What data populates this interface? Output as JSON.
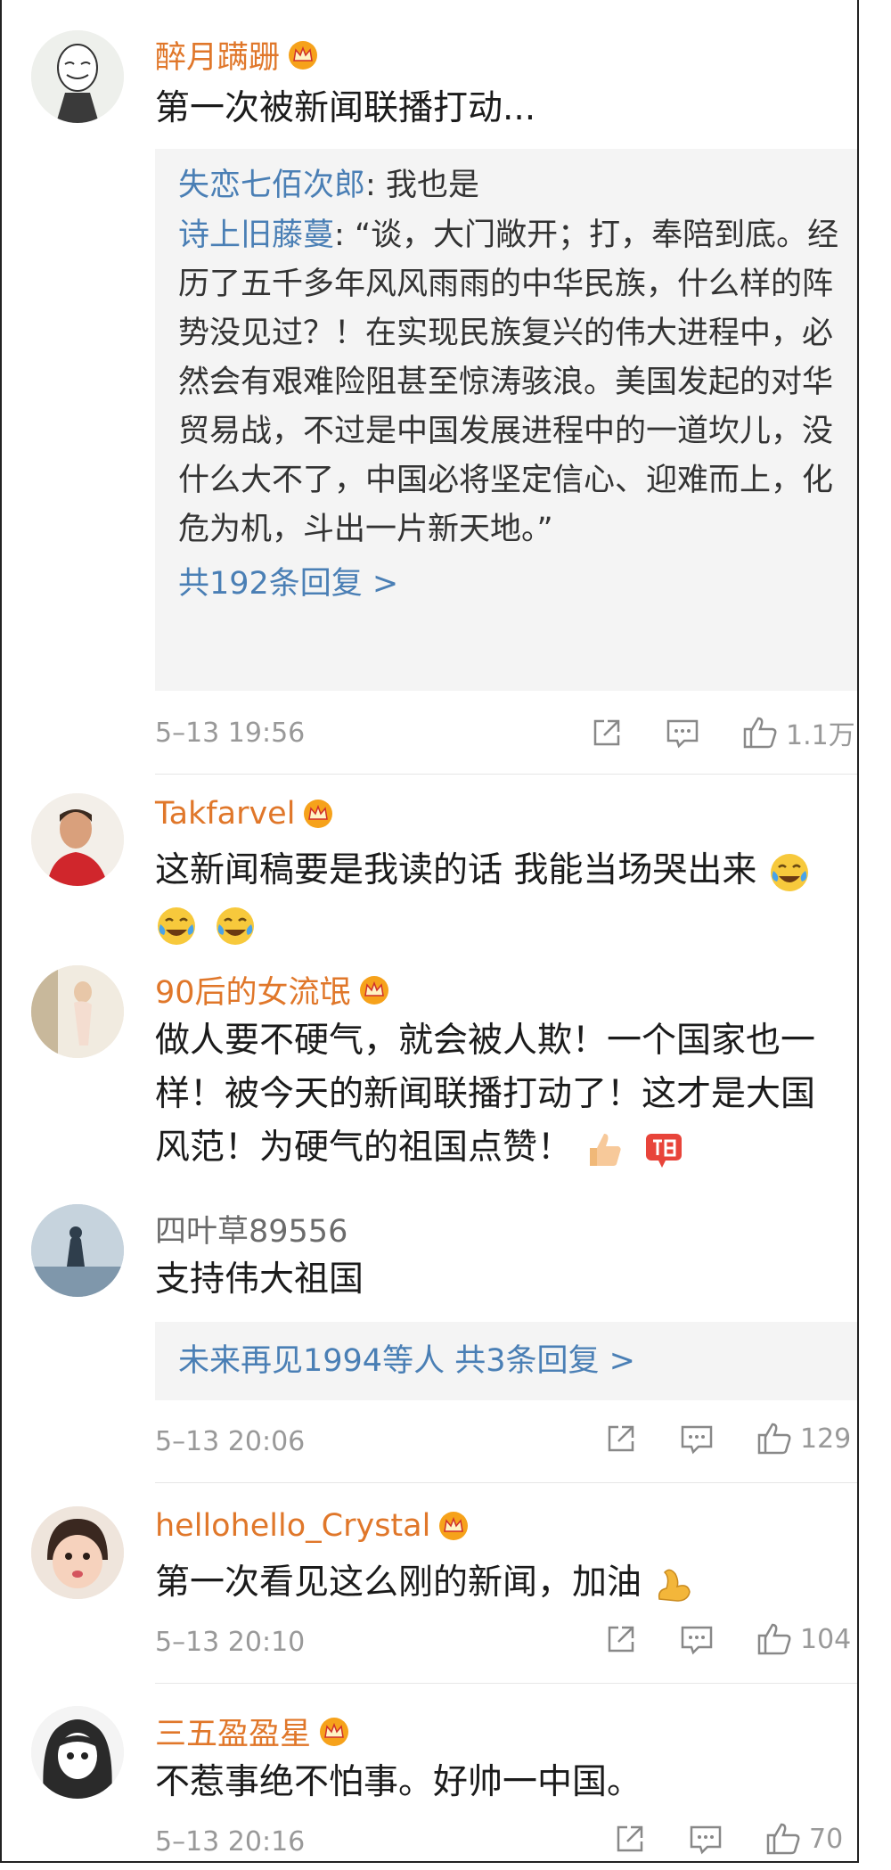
{
  "comments": [
    {
      "name": "醉月蹒跚",
      "text": "第一次被新闻联播打动...",
      "replies": [
        {
          "author": "失恋七佰次郎",
          "sep": ": ",
          "text": "我也是"
        },
        {
          "author": "诗上旧藤蔓",
          "sep": ": ",
          "text": "“谈，大门敞开；打，奉陪到底。经历了五千多年风风雨雨的中华民族，什么样的阵势没见过？！在实现民族复兴的伟大进程中，必然会有艰难险阻甚至惊涛骇浪。美国发起的对华贸易战，不过是中国发展进程中的一道坎儿，没什么大不了，中国必将坚定信心、迎难而上，化危为机，斗出一片新天地。”"
        }
      ],
      "more": "共192条回复 >",
      "time": "5–13 19:56",
      "likes": "1.1万"
    },
    {
      "name": "Takfarvel",
      "text": "这新闻稿要是我读的话 我能当场哭出来"
    },
    {
      "name": "90后的女流氓",
      "text": "做人要不硬气，就会被人欺！一个国家也一样！被今天的新闻联播打动了！这才是大国风范！为硬气的祖国点赞！"
    },
    {
      "name": "四叶草89556",
      "text": "支持伟大祖国",
      "more": "未来再见1994等人  共3条回复 >",
      "time": "5–13 20:06",
      "likes": "129"
    },
    {
      "name": "hellohello_Crystal",
      "text": "第一次看见这么刚的新闻，加油",
      "time": "5–13 20:10",
      "likes": "104"
    },
    {
      "name": "三五盈盈星",
      "text": "不惹事绝不怕事。好帅一中国。",
      "time": "5–13 20:16",
      "likes": "70"
    }
  ],
  "colors": {
    "name": "#e0772a",
    "link": "#4a7fb5",
    "meta": "#999999"
  }
}
